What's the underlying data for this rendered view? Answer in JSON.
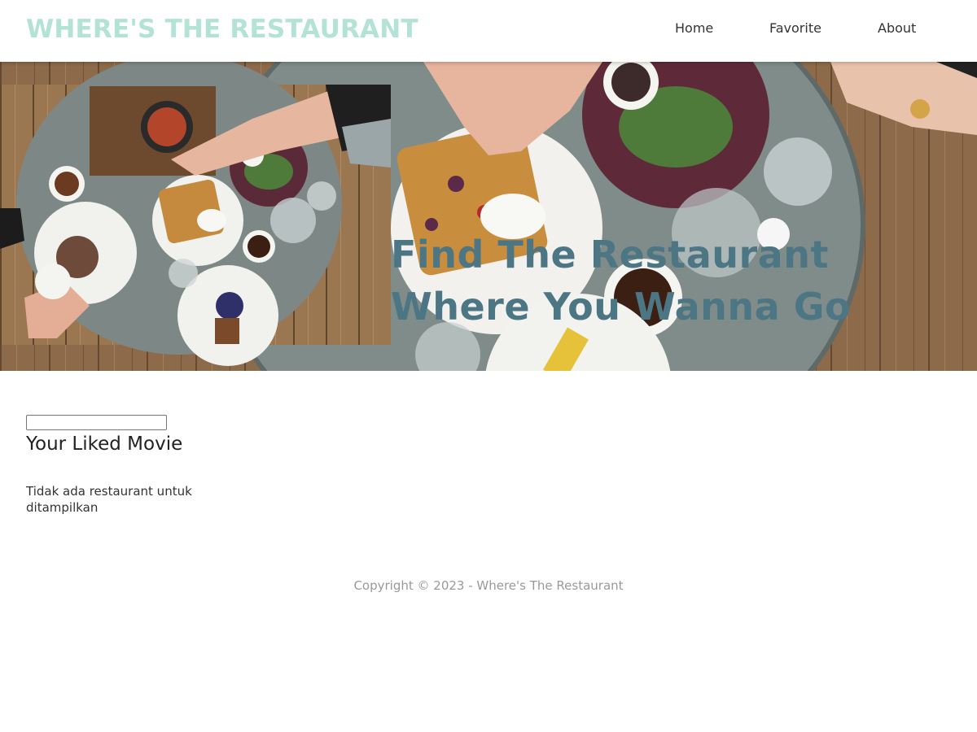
{
  "header": {
    "brand": "WHERE'S THE RESTAURANT",
    "nav": [
      {
        "label": "Home"
      },
      {
        "label": "Favorite"
      },
      {
        "label": "About"
      }
    ]
  },
  "hero": {
    "title": "Find The Restaurant Where You Wanna Go"
  },
  "main": {
    "search": {
      "value": "",
      "placeholder": ""
    },
    "section_title": "Your Liked Movie",
    "empty_message": "Tidak ada restaurant untuk ditampilkan"
  },
  "footer": {
    "text": "Copyright © 2023 - Where's The Restaurant"
  },
  "colors": {
    "brand": "#b3e2d6",
    "hero_title": "#4c7684",
    "footer_text": "#9a9a9a"
  }
}
